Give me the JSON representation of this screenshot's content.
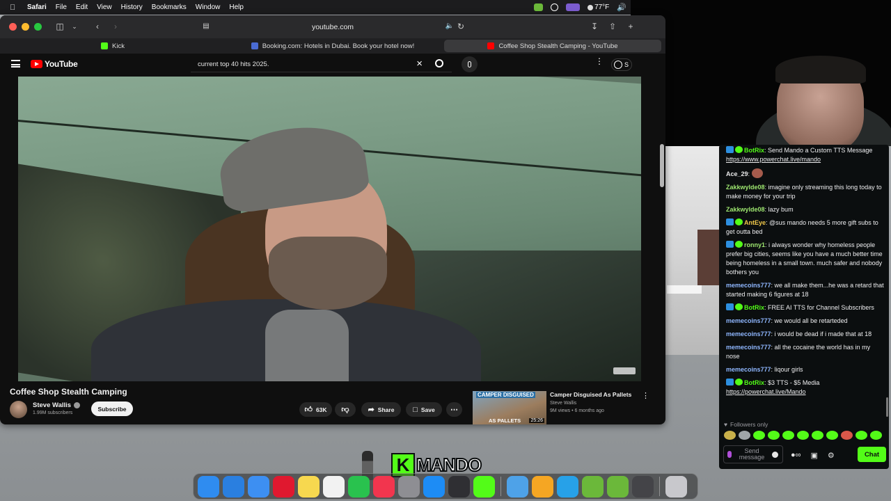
{
  "menubar": {
    "app_name": "Safari",
    "items": [
      "File",
      "Edit",
      "View",
      "History",
      "Bookmarks",
      "Window",
      "Help"
    ],
    "temperature": "77°F",
    "icons": [
      "apple-icon",
      "status-app-icon",
      "screen-record-icon",
      "control-center-icon",
      "weather-icon",
      "volume-icon"
    ]
  },
  "browser": {
    "url": "youtube.com",
    "tabs": [
      {
        "label": "Kick",
        "fav_color": "#53fc18"
      },
      {
        "label": "Booking.com: Hotels in Dubai. Book your hotel now!",
        "fav_color": "#4a6bd3"
      },
      {
        "label": "Coffee Shop Stealth Camping - YouTube",
        "fav_color": "#ff0000"
      }
    ]
  },
  "youtube": {
    "logo_text": "YouTube",
    "search_value": "current top 40 hits 2025.",
    "sign_in_label": "S",
    "video": {
      "title": "Coffee Shop Stealth Camping",
      "channel": "Steve Wallis",
      "subscribers": "1.99M subscribers",
      "subscribe_label": "Subscribe",
      "likes": "63K",
      "share_label": "Share",
      "save_label": "Save"
    },
    "recommended": {
      "title": "Camper Disguised As Pallets",
      "channel": "Steve Wallis",
      "meta": "9M views • 6 months ago",
      "duration": "25:26",
      "thumb_caption_top": "CAMPER DISGUISED",
      "thumb_caption_bottom": "AS PALLETS"
    }
  },
  "chat": {
    "messages": [
      {
        "user": "BotRix",
        "user_color": "#53fc18",
        "badge": true,
        "text": ": Send Mando a Custom TTS Message ",
        "link": "https://www.powerchat.live/mando"
      },
      {
        "user": "Ace_29",
        "user_color": "#e9e9e9",
        "badge": false,
        "text": ": ",
        "emote": true
      },
      {
        "user": "Zakkwylde08",
        "user_color": "#9fe870",
        "badge": false,
        "text": ": imagine only streaming this long today to make money for your trip"
      },
      {
        "user": "Zakkwylde08",
        "user_color": "#9fe870",
        "badge": false,
        "text": ": lazy bum"
      },
      {
        "user": "AntEye",
        "user_color": "#f0c84a",
        "badge": true,
        "text": ": @sus mando needs 5 more gift subs to get outta bed"
      },
      {
        "user": "ronny1",
        "user_color": "#9fe870",
        "badge": true,
        "text": ": i always wonder why homeless people prefer big cities, seems like you have a much better time being homeless in a small town. much safer and nobody bothers you"
      },
      {
        "user": "memecoins777",
        "user_color": "#8fb7ff",
        "badge": false,
        "text": ": we all make them...he was a retard that started making 6 figures at 18"
      },
      {
        "user": "BotRix",
        "user_color": "#53fc18",
        "badge": true,
        "text": ": FREE AI TTS for Channel Subscribers"
      },
      {
        "user": "memecoins777",
        "user_color": "#8fb7ff",
        "badge": false,
        "text": ": we would all be retarteded"
      },
      {
        "user": "memecoins777",
        "user_color": "#8fb7ff",
        "badge": false,
        "text": ": i would be dead if i made that at 18"
      },
      {
        "user": "memecoins777",
        "user_color": "#8fb7ff",
        "badge": false,
        "text": ": all the cocaine the world has in my nose"
      },
      {
        "user": "memecoins777",
        "user_color": "#8fb7ff",
        "badge": false,
        "text": ": liqour girls"
      },
      {
        "user": "BotRix",
        "user_color": "#53fc18",
        "badge": true,
        "text": ": $3 TTS - $5 Media ",
        "link": "https://powerchat.live/Mando"
      }
    ],
    "followers_only": "Followers only",
    "input_placeholder": "Send message",
    "chat_button": "Chat"
  },
  "overlay": {
    "logo_letter": "K",
    "logo_name": "MANDO"
  },
  "dock": {
    "apps": [
      {
        "name": "finder",
        "color": "#2f8cf0"
      },
      {
        "name": "safari",
        "color": "#2a7fe0"
      },
      {
        "name": "mail",
        "color": "#3d8ff2"
      },
      {
        "name": "opera",
        "color": "#e0182f"
      },
      {
        "name": "notes",
        "color": "#f7d84f"
      },
      {
        "name": "reminders",
        "color": "#f2f2f2"
      },
      {
        "name": "whatsapp",
        "color": "#29c24e"
      },
      {
        "name": "music",
        "color": "#f2354e"
      },
      {
        "name": "settings",
        "color": "#8e8e93"
      },
      {
        "name": "app-store",
        "color": "#1d8cf5"
      },
      {
        "name": "obs",
        "color": "#2f2f33"
      },
      {
        "name": "kick-app",
        "color": "#53fc18"
      },
      {
        "name": "preview",
        "color": "#4ea2e8"
      },
      {
        "name": "photos",
        "color": "#f5a623"
      },
      {
        "name": "quicktime",
        "color": "#27a1e8"
      },
      {
        "name": "kick-folder",
        "color": "#6bb83a"
      },
      {
        "name": "kick-folder-2",
        "color": "#6bb83a"
      },
      {
        "name": "screenshots",
        "color": "#444448"
      },
      {
        "name": "trash",
        "color": "#c8c8cc"
      }
    ]
  }
}
